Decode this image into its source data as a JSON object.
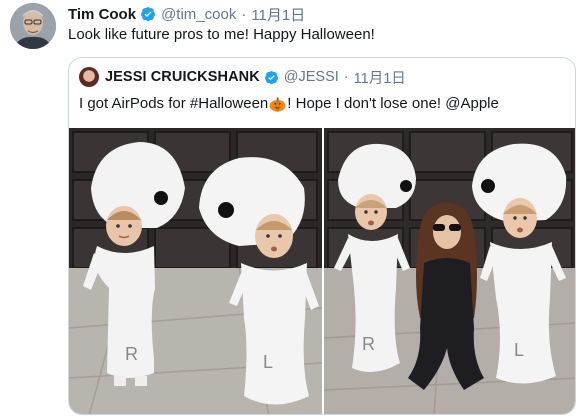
{
  "tweet": {
    "author_name": "Tim Cook",
    "author_handle": "@tim_cook",
    "separator": "·",
    "date": "11月1日",
    "text": "Look like future pros to me! Happy Halloween!"
  },
  "quoted_tweet": {
    "author_name": "JESSI CRUICKSHANK",
    "author_handle": "@JESSI",
    "separator": "·",
    "date": "11月1日",
    "text_before_emoji": "I got AirPods for #Halloween",
    "emoji": "pumpkin-icon",
    "text_after_emoji": "! Hope I don't lose one! @Apple"
  },
  "photos": {
    "left": {
      "costume_letters": [
        "R",
        "L"
      ]
    },
    "right": {
      "costume_letters": [
        "R",
        "L"
      ]
    }
  },
  "colors": {
    "verified_badge": "#1da1f2",
    "muted_text": "#657786",
    "border": "#ccd6dd"
  }
}
